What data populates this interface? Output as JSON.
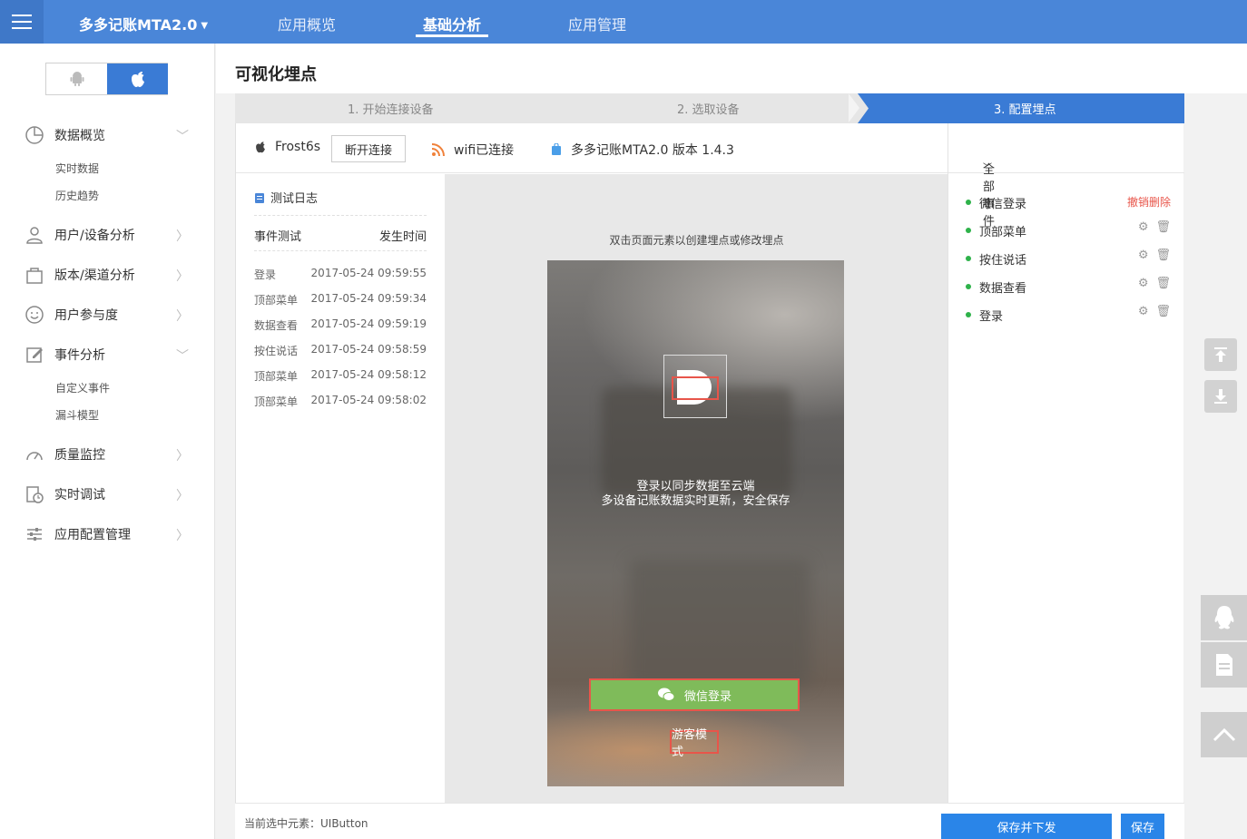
{
  "topbar": {
    "app_title": "多多记账MTA2.0",
    "nav": [
      "应用概览",
      "基础分析",
      "应用管理"
    ],
    "active_nav": "基础分析"
  },
  "sidebar": {
    "os_options": [
      "android",
      "ios"
    ],
    "selected_os": "ios",
    "menu": [
      {
        "label": "数据概览",
        "icon": "pie-chart-icon",
        "expanded": true,
        "children": [
          "实时数据",
          "历史趋势"
        ]
      },
      {
        "label": "用户/设备分析",
        "icon": "user-icon",
        "expanded": false
      },
      {
        "label": "版本/渠道分析",
        "icon": "bag-icon",
        "expanded": false
      },
      {
        "label": "用户参与度",
        "icon": "smile-icon",
        "expanded": false
      },
      {
        "label": "事件分析",
        "icon": "edit-icon",
        "expanded": true,
        "children": [
          "自定义事件",
          "漏斗模型"
        ]
      },
      {
        "label": "质量监控",
        "icon": "gauge-icon",
        "expanded": false
      },
      {
        "label": "实时调试",
        "icon": "debug-clock-icon",
        "expanded": false
      },
      {
        "label": "应用配置管理",
        "icon": "sliders-icon",
        "expanded": false
      }
    ]
  },
  "page": {
    "title": "可视化埋点",
    "steps": [
      "1. 开始连接设备",
      "2. 选取设备",
      "3. 配置埋点"
    ],
    "active_step": 3
  },
  "device": {
    "name": "Frost6s",
    "disconnect_label": "断开连接",
    "wifi_label": "wifi已连接",
    "app_version": "多多记账MTA2.0 版本 1.4.3"
  },
  "log": {
    "title": "测试日志",
    "col_event": "事件测试",
    "col_time": "发生时间",
    "rows": [
      {
        "event": "登录",
        "time": "2017-05-24 09:59:55"
      },
      {
        "event": "顶部菜单",
        "time": "2017-05-24 09:59:34"
      },
      {
        "event": "数据查看",
        "time": "2017-05-24 09:59:19"
      },
      {
        "event": "按住说话",
        "time": "2017-05-24 09:58:59"
      },
      {
        "event": "顶部菜单",
        "time": "2017-05-24 09:58:12"
      },
      {
        "event": "顶部菜单",
        "time": "2017-05-24 09:58:02"
      }
    ]
  },
  "preview": {
    "hint": "双击页面元素以创建埋点或修改埋点",
    "line1": "登录以同步数据至云端",
    "line2": "多设备记账数据实时更新，安全保存",
    "wechat_button": "微信登录",
    "guest_button": "游客模式"
  },
  "events_panel": {
    "filter_label": "全部事件",
    "items": [
      {
        "label": "微信登录",
        "action": "撤销删除"
      },
      {
        "label": "顶部菜单"
      },
      {
        "label": "按住说话"
      },
      {
        "label": "数据查看"
      },
      {
        "label": "登录"
      }
    ]
  },
  "footer": {
    "selected_element": "当前选中元素：UIButton",
    "save_push_label": "保存并下发",
    "save_label": "保存"
  },
  "colors": {
    "topbar": "#4a86d8",
    "accent": "#3a7bd5",
    "primary_button": "#2a85e8",
    "highlight": "#e8554a",
    "event_dot": "#2eb24a",
    "wechat_green": "#7fbb5a"
  }
}
